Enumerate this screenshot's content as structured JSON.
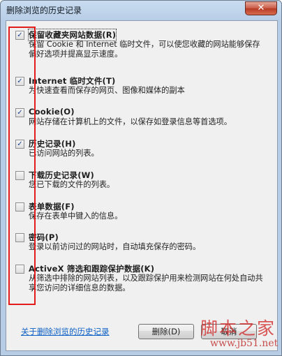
{
  "window": {
    "title": "删除浏览的历史记录",
    "close_symbol": "✕"
  },
  "options": [
    {
      "checked": true,
      "title": "保留收藏夹网站数据(R)",
      "desc": "保留 Cookie 和 Internet 临时文件，可以使您收藏的网站能够保存偏好选项并提高显示速度。"
    },
    {
      "checked": true,
      "title": "Internet 临时文件(T)",
      "desc": "为快速查看而保存的网页、图像和媒体的副本"
    },
    {
      "checked": true,
      "title": "Cookie(O)",
      "desc": "网站存储在计算机上的文件，以保存如登录信息等首选项。"
    },
    {
      "checked": true,
      "title": "历史记录(H)",
      "desc": "已访问网站的列表。"
    },
    {
      "checked": false,
      "title": "下载历史记录(W)",
      "desc": "您已下载的文件的列表。"
    },
    {
      "checked": false,
      "title": "表单数据(F)",
      "desc": "保存在表单中键入的信息。"
    },
    {
      "checked": false,
      "title": "密码(P)",
      "desc": "登录以前访问过的网站时，自动填充保存的密码。"
    },
    {
      "checked": false,
      "title": "ActiveX 筛选和跟踪保护数据(K)",
      "desc": "从筛选中排除的网站列表，以及跟踪保护用来检测网站在何处自动共享您访问的详细信息的数据。"
    }
  ],
  "footer": {
    "about_link": "关于删除浏览的历史记录",
    "delete_label": "删除(D)",
    "cancel_label": "取消"
  },
  "watermark": {
    "name": "脚本之家",
    "url": "www.jb51.net"
  }
}
